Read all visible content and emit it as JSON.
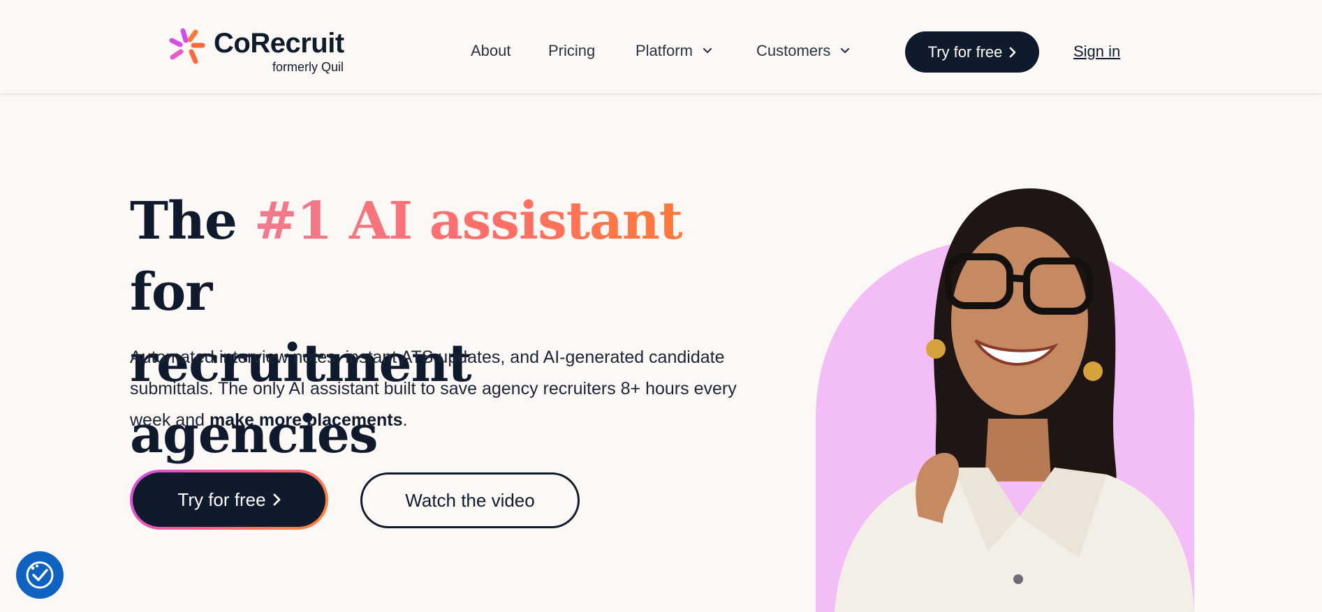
{
  "brand": {
    "name": "CoRecruit",
    "tagline": "formerly Quil",
    "mark_colors": [
      "#d24ee6",
      "#ff6a3d"
    ]
  },
  "nav": {
    "items": [
      {
        "label": "About",
        "dropdown": false
      },
      {
        "label": "Pricing",
        "dropdown": false
      },
      {
        "label": "Platform",
        "dropdown": true
      },
      {
        "label": "Customers",
        "dropdown": true
      }
    ],
    "cta_label": "Try for free",
    "signin_label": "Sign in"
  },
  "hero": {
    "title_pre": "The ",
    "title_highlight": "#1 AI assistant",
    "title_post": " for",
    "title_line2": "recruitment agencies",
    "desc_text": "Automated interview notes, instant ATS updates, and AI-generated candidate submittals. The only AI assistant built to save agency recruiters 8+ hours every week and ",
    "desc_bold": "make more placements",
    "desc_end": ".",
    "primary_cta": "Try for free",
    "secondary_cta": "Watch the video"
  },
  "colors": {
    "background": "#fcf8f5",
    "navy": "#0f1b2d",
    "arch": "#f3bdf8",
    "accessibility_blue": "#0f62c0"
  },
  "icons": {
    "chevron": "chevron-down-icon",
    "arrow": "chevron-right-icon",
    "accessibility": "accessibility-check-icon"
  }
}
